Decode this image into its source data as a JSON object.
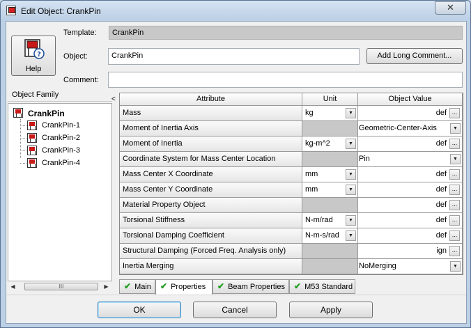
{
  "window": {
    "title": "Edit Object: CrankPin",
    "close_glyph": "✕"
  },
  "help": {
    "label": "Help",
    "icon": "help-question-icon"
  },
  "form": {
    "template_label": "Template:",
    "template_value": "CrankPin",
    "object_label": "Object:",
    "object_value": "CrankPin",
    "comment_label": "Comment:",
    "comment_value": "",
    "long_comment_button": "Add Long Comment..."
  },
  "family": {
    "header": "Object Family",
    "collapse_glyph": "<",
    "root": "CrankPin",
    "children": [
      "CrankPin-1",
      "CrankPin-2",
      "CrankPin-3",
      "CrankPin-4"
    ],
    "scroll_thumb": "III"
  },
  "grid": {
    "columns": [
      "Attribute",
      "Unit",
      "Object Value"
    ],
    "rows": [
      {
        "attribute": "Mass",
        "unit": "kg",
        "value": "def",
        "unit_dropdown": true,
        "value_kind": "text"
      },
      {
        "attribute": "Moment of Inertia Axis",
        "unit": "",
        "value": "Geometric-Center-Axis",
        "unit_dropdown": false,
        "value_kind": "dropdown"
      },
      {
        "attribute": "Moment of Inertia",
        "unit": "kg-m^2",
        "value": "def",
        "unit_dropdown": true,
        "value_kind": "text"
      },
      {
        "attribute": "Coordinate System for Mass Center Location",
        "unit": "",
        "value": "Pin",
        "unit_dropdown": false,
        "value_kind": "dropdown"
      },
      {
        "attribute": "Mass Center X Coordinate",
        "unit": "mm",
        "value": "def",
        "unit_dropdown": true,
        "value_kind": "text"
      },
      {
        "attribute": "Mass Center Y Coordinate",
        "unit": "mm",
        "value": "def",
        "unit_dropdown": true,
        "value_kind": "text"
      },
      {
        "attribute": "Material Property Object",
        "unit": "",
        "value": "def",
        "unit_dropdown": false,
        "value_kind": "text"
      },
      {
        "attribute": "Torsional Stiffness",
        "unit": "N-m/rad",
        "value": "def",
        "unit_dropdown": true,
        "value_kind": "text"
      },
      {
        "attribute": "Torsional Damping Coefficient",
        "unit": "N-m-s/rad",
        "value": "def",
        "unit_dropdown": true,
        "value_kind": "text"
      },
      {
        "attribute": "Structural Damping (Forced Freq. Analysis only)",
        "unit": "",
        "value": "ign",
        "unit_dropdown": false,
        "value_kind": "text"
      },
      {
        "attribute": "Inertia Merging",
        "unit": "",
        "value": "NoMerging",
        "unit_dropdown": false,
        "value_kind": "dropdown"
      }
    ],
    "ellipsis_glyph": "...",
    "dropdown_glyph": "▼"
  },
  "tabs": [
    {
      "label": "Main",
      "active": false
    },
    {
      "label": "Properties",
      "active": true
    },
    {
      "label": "Beam Properties",
      "active": false
    },
    {
      "label": "M53 Standard",
      "active": false
    }
  ],
  "check_glyph": "✔",
  "buttons": {
    "ok": "OK",
    "cancel": "Cancel",
    "apply": "Apply"
  },
  "colors": {
    "accent_red": "#c81818",
    "check_green": "#1e9e1e",
    "readonly_gray": "#c8c8c8"
  }
}
